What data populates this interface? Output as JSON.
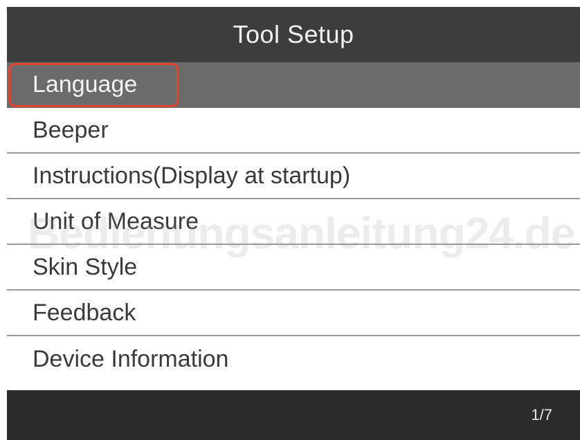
{
  "title": "Tool Setup",
  "menu": {
    "selected_index": 0,
    "items": [
      {
        "label": "Language"
      },
      {
        "label": "Beeper"
      },
      {
        "label": "Instructions(Display at startup)"
      },
      {
        "label": "Unit of Measure"
      },
      {
        "label": "Skin Style"
      },
      {
        "label": "Feedback"
      },
      {
        "label": "Device Information"
      }
    ]
  },
  "footer": {
    "page_indicator": "1/7"
  },
  "watermark": "Bedienungsanleitung24.de",
  "colors": {
    "title_bar": "#3d3d3d",
    "selected_row": "#6b6b6b",
    "highlight_outline": "#e8412c",
    "footer_bar": "#2b2b2b"
  }
}
